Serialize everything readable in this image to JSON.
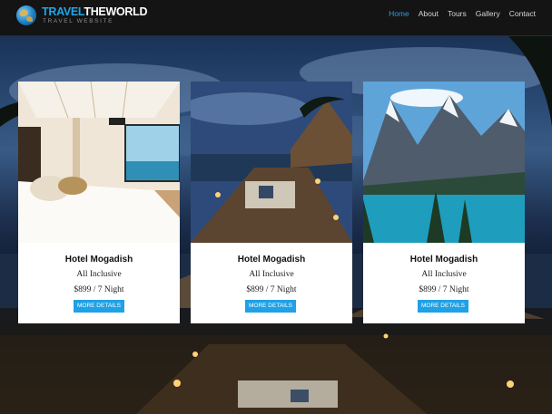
{
  "brand": {
    "name_part1": "TRAVEL",
    "name_part2": "THEWORLD",
    "tagline": "TRAVEL WEBSITE",
    "icon": "globe-icon"
  },
  "nav": {
    "items": [
      {
        "label": "Home",
        "active": true
      },
      {
        "label": "About",
        "active": false
      },
      {
        "label": "Tours",
        "active": false
      },
      {
        "label": "Gallery",
        "active": false
      },
      {
        "label": "Contact",
        "active": false
      }
    ]
  },
  "cards": [
    {
      "title": "Hotel Mogadish",
      "package": "All Inclusive",
      "price": "$899 / 7 Night",
      "button": "MORE DETAILS",
      "image": "hotel-bedroom-photo"
    },
    {
      "title": "Hotel Mogadish",
      "package": "All Inclusive",
      "price": "$899 / 7 Night",
      "button": "MORE DETAILS",
      "image": "resort-deck-photo"
    },
    {
      "title": "Hotel Mogadish",
      "package": "All Inclusive",
      "price": "$899 / 7 Night",
      "button": "MORE DETAILS",
      "image": "mountain-lake-photo"
    }
  ],
  "colors": {
    "accent": "#1fa1e6",
    "nav_bg": "#141414",
    "nav_active": "#2b9be8"
  }
}
